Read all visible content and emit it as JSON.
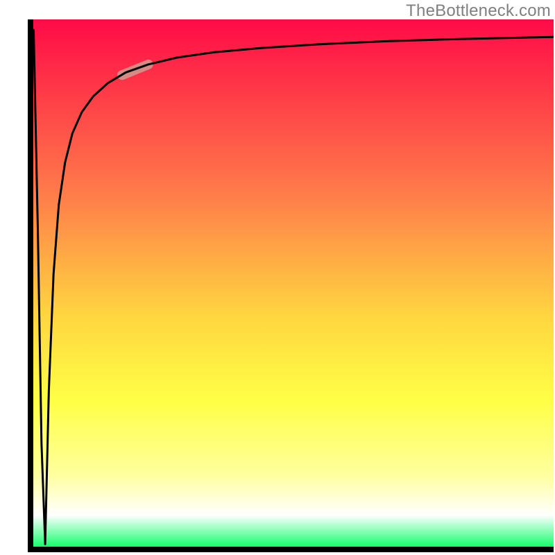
{
  "watermark": "TheBottleneck.com",
  "colors": {
    "gradient_top": "#ff0b47",
    "gradient_mid_upper": "#ff804a",
    "gradient_mid": "#ffd640",
    "gradient_mid_lower": "#ffff46",
    "gradient_lower": "#ffffa0",
    "gradient_bottom": "#00ff60",
    "axis": "#000000",
    "curve": "#000000",
    "highlight": "#cf9b90"
  },
  "chart_data": {
    "type": "line",
    "title": "",
    "xlabel": "",
    "ylabel": "",
    "xlim": [
      0,
      100
    ],
    "ylim": [
      0,
      100
    ],
    "background_gradient": [
      {
        "stop": 0.0,
        "color": "#ff0b47"
      },
      {
        "stop": 0.34,
        "color": "#ff804a"
      },
      {
        "stop": 0.56,
        "color": "#ffd640"
      },
      {
        "stop": 0.72,
        "color": "#ffff46"
      },
      {
        "stop": 0.86,
        "color": "#ffffa0"
      },
      {
        "stop": 0.935,
        "color": "#ffffff"
      },
      {
        "stop": 1.0,
        "color": "#00ff60"
      }
    ],
    "series": [
      {
        "name": "initial-drop",
        "x": [
          0.6,
          1.4,
          2.1,
          2.8
        ],
        "values": [
          98,
          60,
          20,
          1
        ]
      },
      {
        "name": "recovery-curve",
        "x": [
          2.8,
          3.5,
          4.4,
          5.4,
          6.6,
          8.0,
          9.8,
          12.0,
          14.8,
          18.2,
          22.5,
          28.0,
          35.0,
          44.0,
          55.0,
          68.0,
          82.0,
          100.0
        ],
        "values": [
          1,
          30,
          52,
          65,
          73,
          78.5,
          82.5,
          85.5,
          88,
          90,
          91.5,
          92.8,
          93.8,
          94.6,
          95.3,
          95.9,
          96.3,
          96.7
        ]
      }
    ],
    "annotations": [
      {
        "name": "highlight-segment",
        "x_range": [
          17.5,
          22.5
        ],
        "y_range": [
          89.5,
          91.5
        ]
      }
    ]
  }
}
